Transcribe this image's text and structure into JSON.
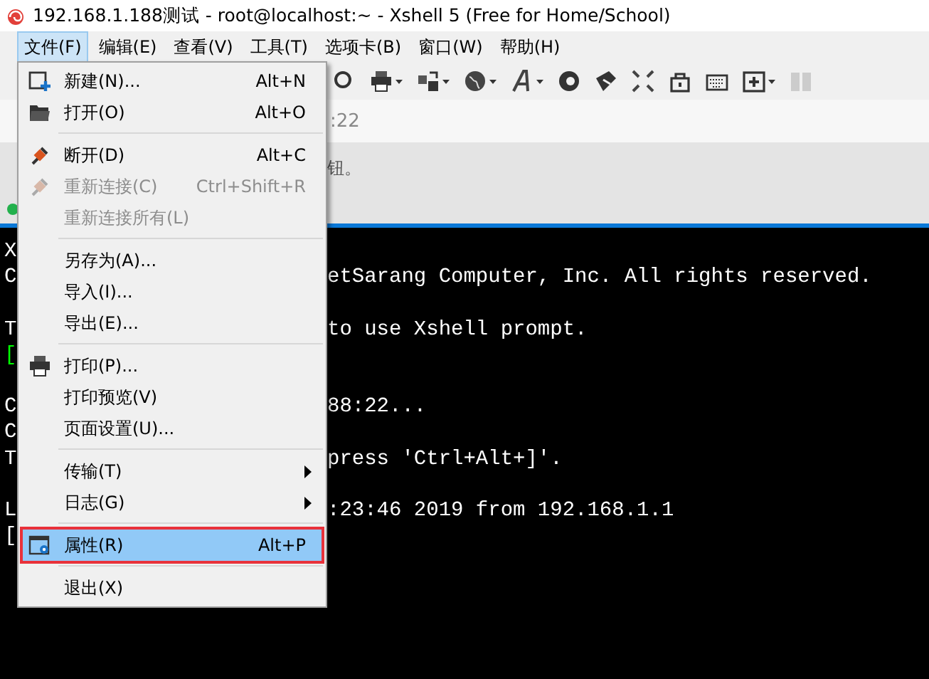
{
  "window": {
    "title": "192.168.1.188测试 - root@localhost:~ - Xshell 5 (Free for Home/School)"
  },
  "menubar": [
    {
      "label": "文件(F)",
      "selected": true
    },
    {
      "label": "编辑(E)",
      "selected": false
    },
    {
      "label": "查看(V)",
      "selected": false
    },
    {
      "label": "工具(T)",
      "selected": false
    },
    {
      "label": "选项卡(B)",
      "selected": false
    },
    {
      "label": "窗口(W)",
      "selected": false
    },
    {
      "label": "帮助(H)",
      "selected": false
    }
  ],
  "address_bar": {
    "value": ":22"
  },
  "hint_bar": {
    "text": "钮。"
  },
  "file_menu": [
    {
      "kind": "item",
      "label": "新建(N)...",
      "shortcut": "Alt+N",
      "disabled": false,
      "selected": false,
      "submenu": false,
      "outlined": false
    },
    {
      "kind": "item",
      "label": "打开(O)",
      "shortcut": "Alt+O",
      "disabled": false,
      "selected": false,
      "submenu": false,
      "outlined": false
    },
    {
      "kind": "separator"
    },
    {
      "kind": "item",
      "label": "断开(D)",
      "shortcut": "Alt+C",
      "disabled": false,
      "selected": false,
      "submenu": false,
      "outlined": false
    },
    {
      "kind": "item",
      "label": "重新连接(C)",
      "shortcut": "Ctrl+Shift+R",
      "disabled": true,
      "selected": false,
      "submenu": false,
      "outlined": false
    },
    {
      "kind": "item",
      "label": "重新连接所有(L)",
      "disabled": true,
      "selected": false,
      "submenu": false,
      "outlined": false
    },
    {
      "kind": "separator"
    },
    {
      "kind": "item",
      "label": "另存为(A)...",
      "disabled": false,
      "selected": false,
      "submenu": false,
      "outlined": false
    },
    {
      "kind": "item",
      "label": "导入(I)...",
      "disabled": false,
      "selected": false,
      "submenu": false,
      "outlined": false
    },
    {
      "kind": "item",
      "label": "导出(E)...",
      "disabled": false,
      "selected": false,
      "submenu": false,
      "outlined": false
    },
    {
      "kind": "separator"
    },
    {
      "kind": "item",
      "label": "打印(P)...",
      "disabled": false,
      "selected": false,
      "submenu": false,
      "outlined": false
    },
    {
      "kind": "item",
      "label": "打印预览(V)",
      "disabled": false,
      "selected": false,
      "submenu": false,
      "outlined": false
    },
    {
      "kind": "item",
      "label": "页面设置(U)...",
      "disabled": false,
      "selected": false,
      "submenu": false,
      "outlined": false
    },
    {
      "kind": "separator"
    },
    {
      "kind": "item",
      "label": "传输(T)",
      "disabled": false,
      "selected": false,
      "submenu": true,
      "outlined": false
    },
    {
      "kind": "item",
      "label": "日志(G)",
      "disabled": false,
      "selected": false,
      "submenu": true,
      "outlined": false
    },
    {
      "kind": "separator"
    },
    {
      "kind": "item",
      "label": "属性(R)",
      "shortcut": "Alt+P",
      "disabled": false,
      "selected": true,
      "submenu": false,
      "outlined": true
    },
    {
      "kind": "separator"
    },
    {
      "kind": "item",
      "label": "退出(X)",
      "disabled": false,
      "selected": false,
      "submenu": false,
      "outlined": false
    }
  ],
  "terminal": [
    {
      "kind": "text",
      "left": "X",
      "color": "#ffffff"
    },
    {
      "kind": "text",
      "left": "C",
      "right": "etSarang Computer, Inc. All rights reserved.",
      "color": "#ffffff"
    },
    {
      "kind": "blank"
    },
    {
      "kind": "text",
      "left": "T",
      "right": "to use Xshell prompt.",
      "color": "#ffffff"
    },
    {
      "kind": "text",
      "left": "[",
      "color": "#00ff00"
    },
    {
      "kind": "blank"
    },
    {
      "kind": "text",
      "left": "C",
      "right": "88:22...",
      "color": "#ffffff"
    },
    {
      "kind": "text",
      "left": "C",
      "color": "#ffffff"
    },
    {
      "kind": "text",
      "left": "T",
      "right": "press 'Ctrl+Alt+]'.",
      "color": "#ffffff"
    },
    {
      "kind": "blank"
    },
    {
      "kind": "text",
      "left": "L",
      "right": ":23:46 2019 from 192.168.1.1",
      "color": "#ffffff"
    },
    {
      "kind": "text",
      "left": "[",
      "color": "#ffffff"
    }
  ]
}
